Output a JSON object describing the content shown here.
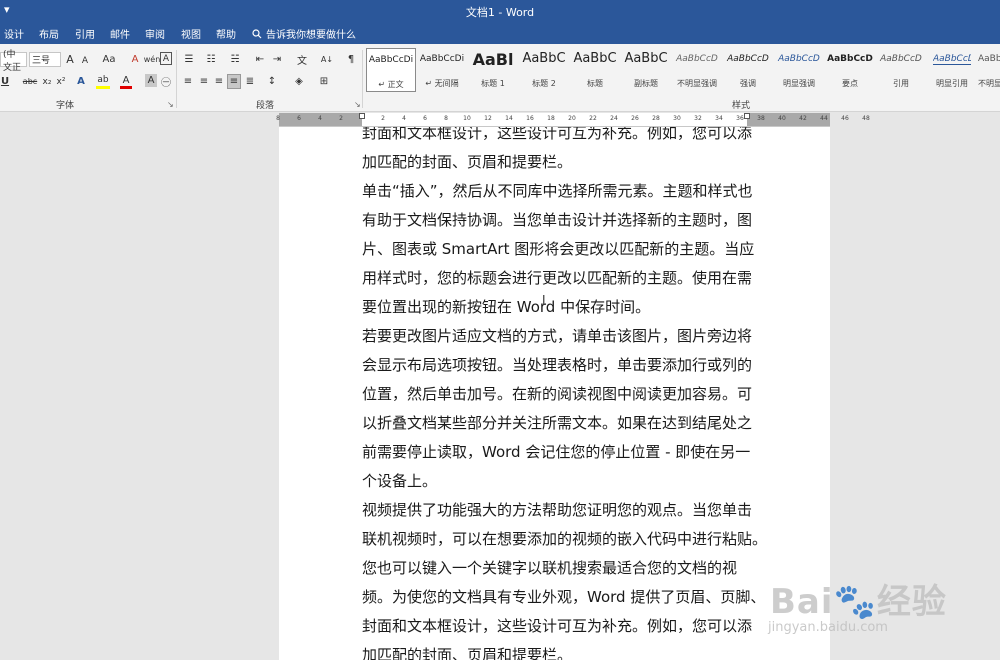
{
  "window": {
    "quick_access": "▾",
    "title": "文档1  -  Word"
  },
  "tabs": [
    {
      "label": "设计"
    },
    {
      "label": "布局"
    },
    {
      "label": "引用"
    },
    {
      "label": "邮件"
    },
    {
      "label": "审阅"
    },
    {
      "label": "视图"
    },
    {
      "label": "帮助"
    }
  ],
  "tell_me": {
    "icon": "lightbulb-icon",
    "label": "告诉我你想要做什么"
  },
  "font_group": {
    "font_name": "(中文正",
    "font_size": "三号",
    "grow": "A",
    "shrink": "A",
    "case": "Aa",
    "clear_format": "A",
    "phonetic": "wén",
    "char_border": "A",
    "underline": "U",
    "strike": "abc",
    "subscript": "x₂",
    "superscript": "x²",
    "text_effect": "A",
    "highlight": "ab",
    "font_color": "A",
    "char_shading": "A",
    "enclose": "㊀",
    "label": "字体",
    "launcher": "↘"
  },
  "paragraph_group": {
    "bullets": "☰",
    "numbering": "☷",
    "multilevel": "☵",
    "decrease_indent": "⇤",
    "increase_indent": "⇥",
    "chinese_layout": "文",
    "sort": "A↓",
    "show_marks": "¶",
    "align_left": "≡",
    "center": "≡",
    "align_right": "≡",
    "justify": "≡",
    "distributed": "≣",
    "line_spacing": "↕",
    "shading": "◈",
    "borders": "⊞",
    "label": "段落",
    "launcher": "↘"
  },
  "styles": {
    "items": [
      {
        "preview": "AaBbCcDi",
        "name": "↵ 正文",
        "size": 9
      },
      {
        "preview": "AaBbCcDi",
        "name": "↵ 无间隔",
        "size": 9
      },
      {
        "preview": "AaBl",
        "name": "标题 1",
        "size": 16
      },
      {
        "preview": "AaBbC",
        "name": "标题 2",
        "size": 13
      },
      {
        "preview": "AaBbC",
        "name": "标题",
        "size": 13
      },
      {
        "preview": "AaBbC",
        "name": "副标题",
        "size": 13
      },
      {
        "preview": "AaBbCcD",
        "name": "不明显强调",
        "size": 9
      },
      {
        "preview": "AaBbCcD",
        "name": "强调",
        "size": 9
      },
      {
        "preview": "AaBbCcD",
        "name": "明显强调",
        "size": 9
      },
      {
        "preview": "AaBbCcD",
        "name": "要点",
        "size": 9
      },
      {
        "preview": "AaBbCcD",
        "name": "引用",
        "size": 9
      },
      {
        "preview": "AaBbCcD",
        "name": "明显引用",
        "size": 9
      },
      {
        "preview": "AaBbCcD",
        "name": "不明显参",
        "size": 9
      }
    ],
    "label": "样式",
    "colors": {
      "emphasis": "#2b579a",
      "subtle": "#666666"
    }
  },
  "editing": {
    "icon": "magic-wand-icon",
    "label": "⁄"
  },
  "ruler": {
    "numbers": [
      "8",
      "6",
      "4",
      "2",
      "2",
      "4",
      "6",
      "8",
      "10",
      "12",
      "14",
      "16",
      "18",
      "20",
      "22",
      "24",
      "26",
      "28",
      "30",
      "32",
      "34",
      "36",
      "38",
      "40",
      "42",
      "44",
      "46",
      "48"
    ]
  },
  "document": {
    "lines": [
      "封面和文本框设计，这些设计可互为补充。例如，您可以添",
      "加匹配的封面、页眉和提要栏。",
      "单击“插入”，然后从不同库中选择所需元素。主题和样式也",
      "有助于文档保持协调。当您单击设计并选择新的主题时，图",
      "片、图表或 SmartArt 图形将会更改以匹配新的主题。当应",
      "用样式时，您的标题会进行更改以匹配新的主题。使用在需",
      "要位置出现的新按钮在 Word 中保存时间。",
      "若要更改图片适应文档的方式，请单击该图片，图片旁边将",
      "会显示布局选项按钮。当处理表格时，单击要添加行或列的",
      "位置，然后单击加号。在新的阅读视图中阅读更加容易。可",
      "以折叠文档某些部分并关注所需文本。如果在达到结尾处之",
      "前需要停止读取，Word 会记住您的停止位置 - 即使在另一",
      "个设备上。",
      "视频提供了功能强大的方法帮助您证明您的观点。当您单击",
      "联机视频时，可以在想要添加的视频的嵌入代码中进行粘贴。",
      "您也可以键入一个关键字以联机搜索最适合您的文档的视",
      "频。为使您的文档具有专业外观，Word 提供了页眉、页脚、",
      "封面和文本框设计，这些设计可互为补充。例如，您可以添",
      "加匹配的封面、页眉和提要栏。"
    ],
    "cursor": "I"
  },
  "watermark": {
    "main": "Bai🐾经验",
    "url": "jingyan.baidu.com"
  },
  "colors": {
    "titlebar": "#2b579a",
    "ribbon": "#f3f3f3",
    "canvas": "#e6e6e6"
  }
}
